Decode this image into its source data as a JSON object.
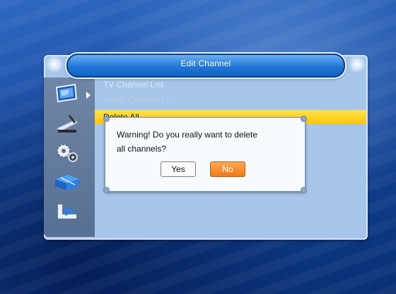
{
  "header": {
    "title": "Edit Channel"
  },
  "menu": {
    "items": [
      {
        "label": "TV Channel List"
      },
      {
        "label": "Radio Channel List"
      },
      {
        "label": "Delete All"
      }
    ]
  },
  "sidebar": {
    "icons": [
      "monitor-icon",
      "satellite-dish-icon",
      "gears-icon",
      "network-icon",
      "media-icon"
    ]
  },
  "dialog": {
    "message": "Warning! Do you really want to delete\nall channels?",
    "yes_label": "Yes",
    "no_label": "No",
    "focused": "No"
  },
  "colors": {
    "selection": "#ffc60a",
    "focused_button": "#f07a14",
    "header": "#1f77d8"
  }
}
